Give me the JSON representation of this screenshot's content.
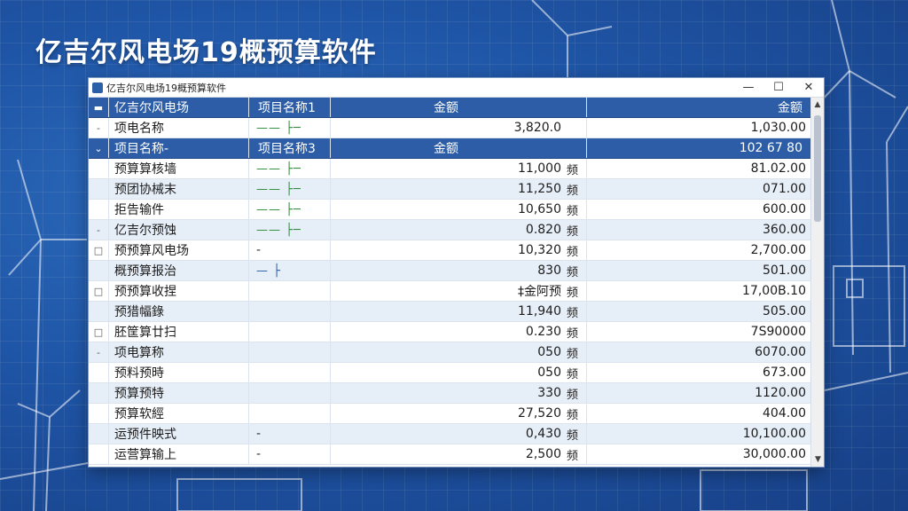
{
  "slide": {
    "title": "亿吉尔风电场19概预算软件"
  },
  "window": {
    "title": "亿吉尔风电场19概预算软件",
    "controls": {
      "minimize": "—",
      "maximize": "☐",
      "close": "✕"
    }
  },
  "grid": {
    "rows": [
      {
        "type": "header",
        "expander": "▬",
        "name": "亿吉尔风电场",
        "col2": "项目名称1",
        "amount1": "金额",
        "unit": "",
        "amount2": "金额"
      },
      {
        "type": "data",
        "expander": "-",
        "name": "项电名称",
        "col2": "—— ├─",
        "amount1": "3,820.0",
        "unit": "",
        "amount2": "1,030.00"
      },
      {
        "type": "header",
        "expander": "⌄",
        "name": "项目名称-",
        "col2": "项目名称3",
        "amount1": "金额",
        "unit": "",
        "amount2": "102 67 80"
      },
      {
        "type": "data",
        "expander": "",
        "name": "预算算核墙",
        "col2": "—— ├─",
        "amount1": "11,000",
        "unit": "频",
        "amount2": "81.02.00"
      },
      {
        "type": "data",
        "expander": "",
        "name": "预团协械末",
        "col2": "—— ├─",
        "amount1": "11,250",
        "unit": "频",
        "amount2": "071.00"
      },
      {
        "type": "data",
        "expander": "",
        "name": "拒告输件",
        "col2": "—— ├─",
        "amount1": "10,650",
        "unit": "频",
        "amount2": "600.00"
      },
      {
        "type": "data",
        "expander": "-",
        "name": "亿吉尔预蚀",
        "col2": "—— ├─",
        "amount1": "0.820",
        "unit": "频",
        "amount2": "360.00"
      },
      {
        "type": "data",
        "expander": "□",
        "name": "预预算风电场",
        "col2": "-",
        "amount1": "10,320",
        "unit": "频",
        "amount2": "2,700.00"
      },
      {
        "type": "data",
        "expander": "",
        "name": "概预算报治",
        "col2": "— ├",
        "amount1": "830",
        "unit": "频",
        "amount2": "501.00"
      },
      {
        "type": "data",
        "expander": "□",
        "name": "预预算收捏",
        "col2": "",
        "amount1": "‡金阿预",
        "unit": "频",
        "amount2": "17,00B.10"
      },
      {
        "type": "data",
        "expander": "",
        "name": "预猎幅錄",
        "col2": "",
        "amount1": "11,940",
        "unit": "频",
        "amount2": "505.00"
      },
      {
        "type": "data",
        "expander": "□",
        "name": "胚筐算廿扫",
        "col2": "",
        "amount1": "0.230",
        "unit": "频",
        "amount2": "7S90000"
      },
      {
        "type": "data",
        "expander": "-",
        "name": "项电算称",
        "col2": "",
        "amount1": "050",
        "unit": "频",
        "amount2": "6070.00"
      },
      {
        "type": "data",
        "expander": "",
        "name": "预料预時",
        "col2": "",
        "amount1": "050",
        "unit": "频",
        "amount2": "673.00"
      },
      {
        "type": "data",
        "expander": "",
        "name": "预算预特",
        "col2": "",
        "amount1": "330",
        "unit": "频",
        "amount2": "1120.00"
      },
      {
        "type": "data",
        "expander": "",
        "name": "预算软經",
        "col2": "",
        "amount1": "27,520",
        "unit": "频",
        "amount2": "404.00"
      },
      {
        "type": "data",
        "expander": "",
        "name": "运预件映式",
        "col2": "-",
        "amount1": "0,430",
        "unit": "频",
        "amount2": "10,100.00"
      },
      {
        "type": "data",
        "expander": "",
        "name": "运营算输上",
        "col2": "-",
        "amount1": "2,500",
        "unit": "频",
        "amount2": "30,000.00"
      }
    ]
  },
  "scrollbar": {
    "up": "▲",
    "down": "▼"
  }
}
